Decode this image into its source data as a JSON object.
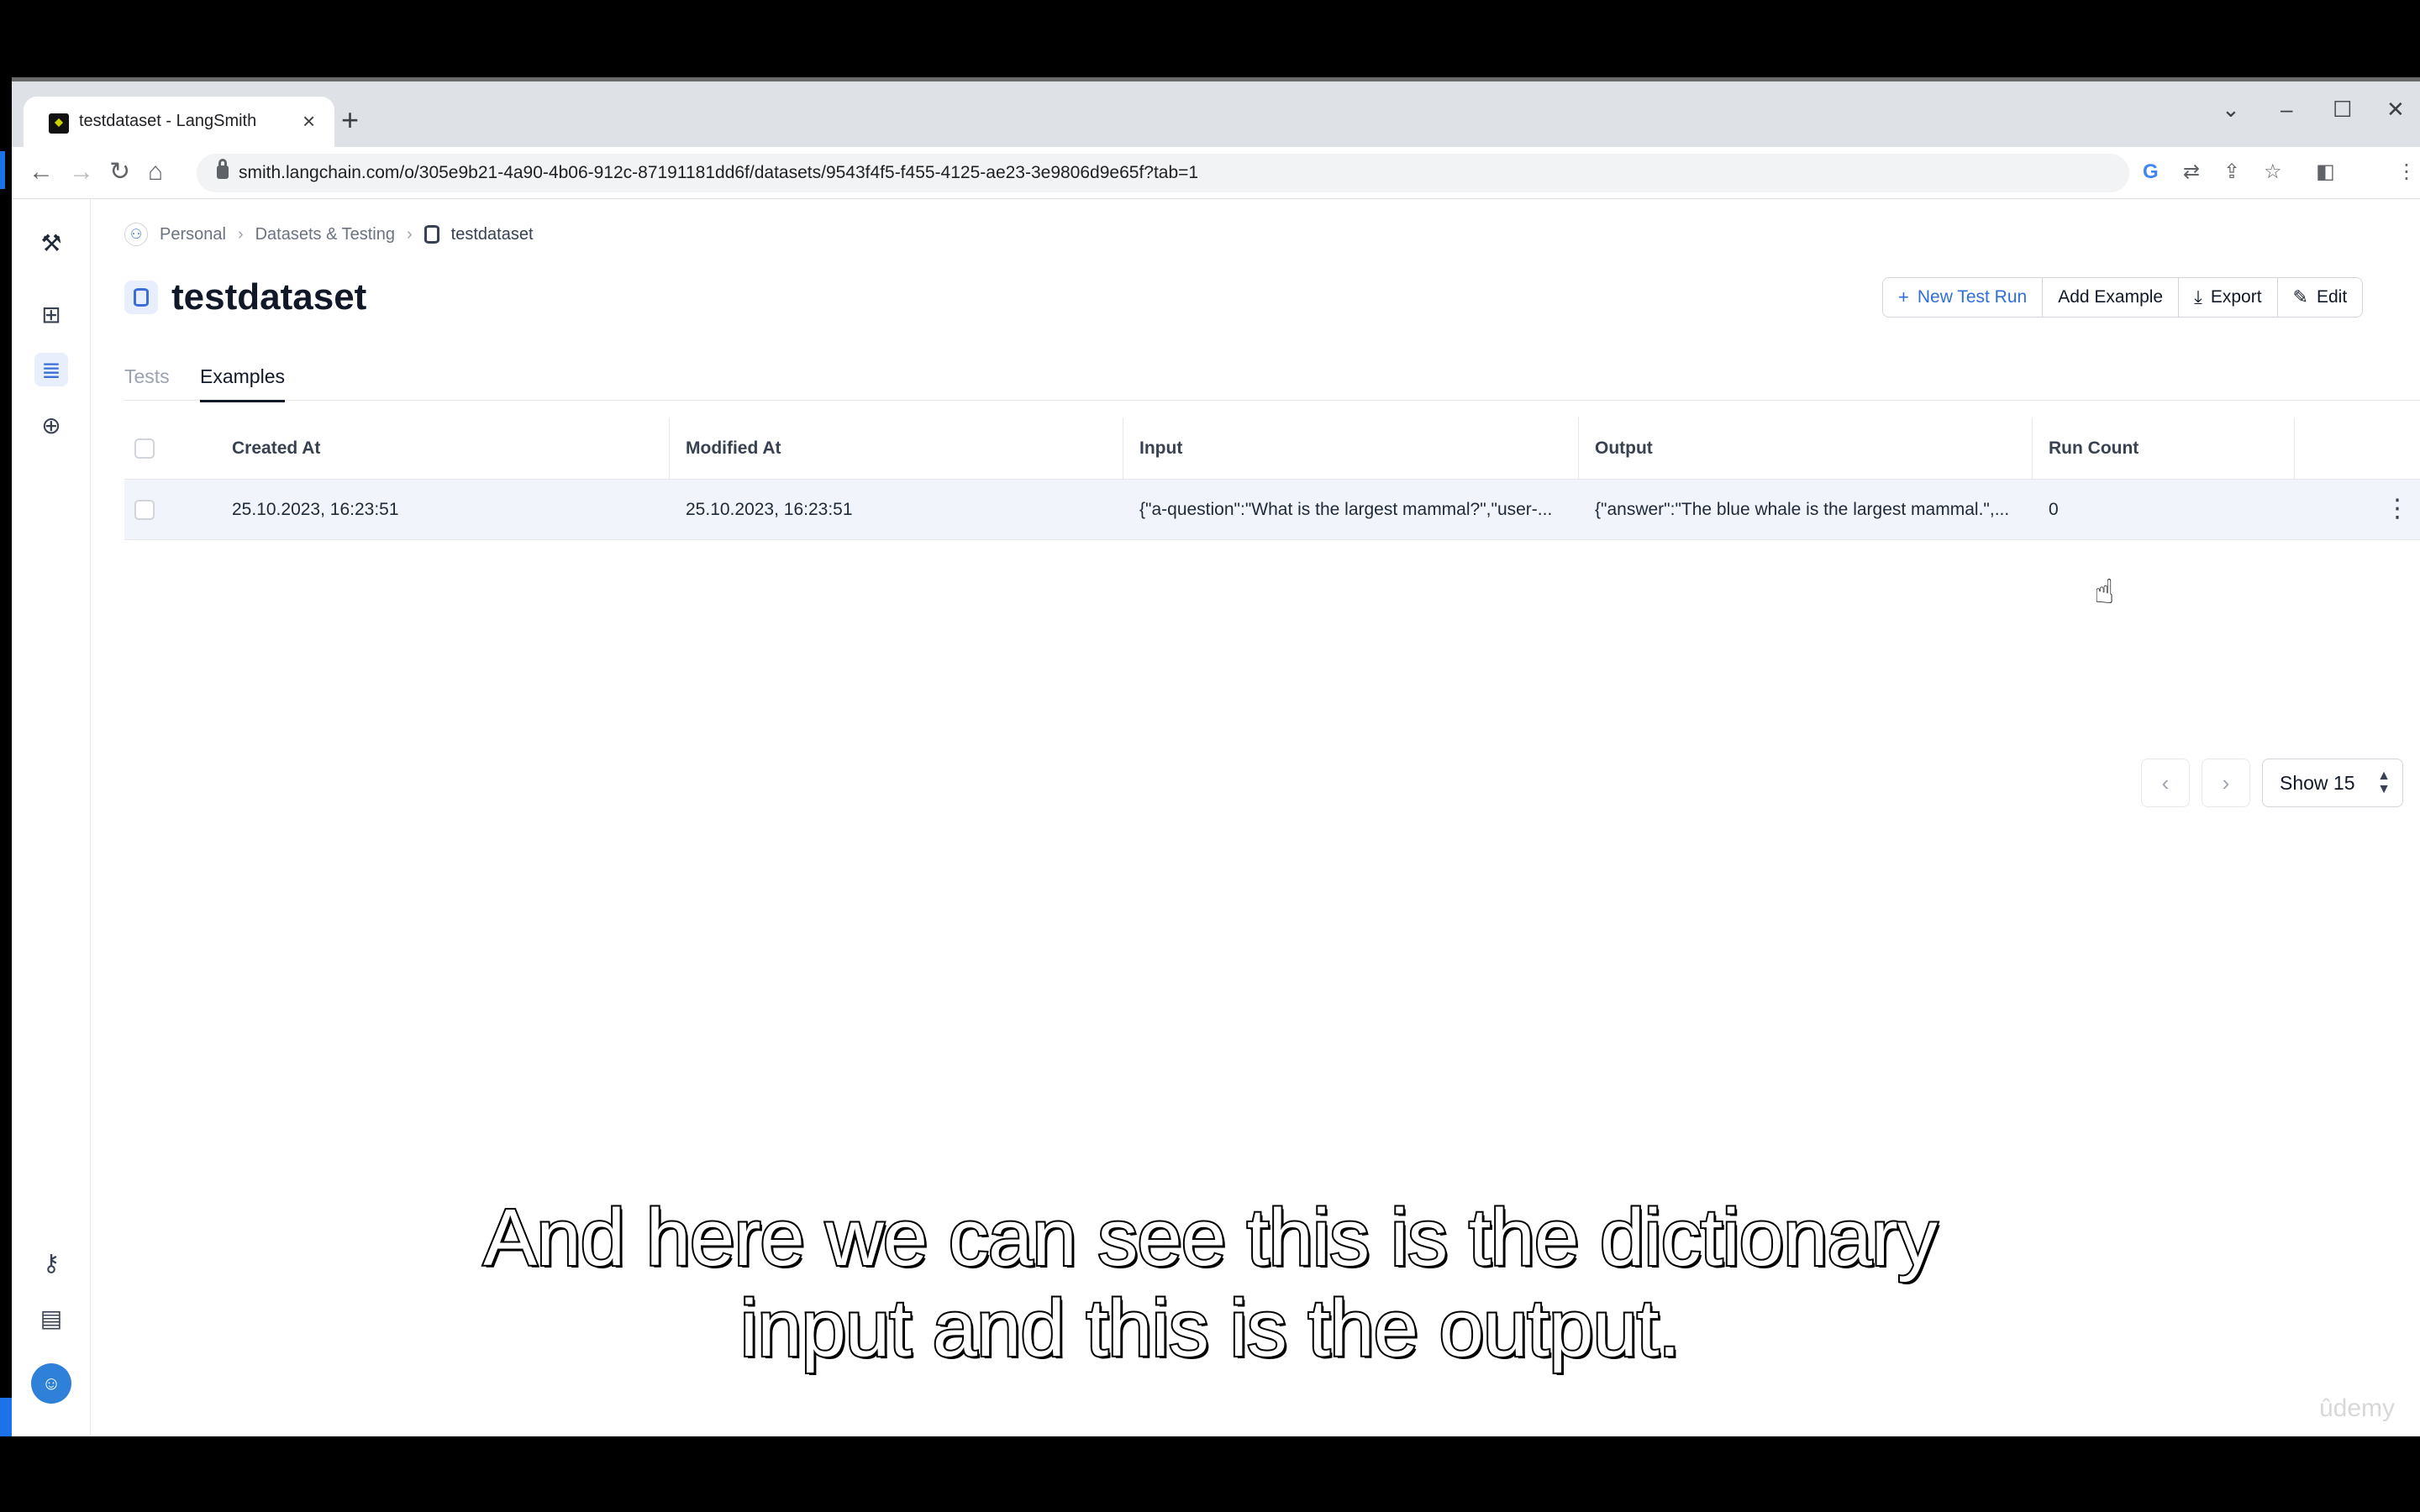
{
  "browser": {
    "tab_title": "testdataset - LangSmith",
    "tab_close": "×",
    "new_tab": "+",
    "url": "smith.langchain.com/o/305e9b21-4a90-4b06-912c-87191181dd6f/datasets/9543f4f5-f455-4125-ae23-3e9806d9e65f?tab=1",
    "nav": {
      "back": "←",
      "forward": "→",
      "reload": "↻",
      "home": "⌂"
    },
    "window": {
      "tabsearch": "⌄",
      "minimize": "–",
      "maximize": "☐",
      "close": "✕"
    },
    "extensions": [
      "G",
      "⇄",
      "⇪",
      "☆",
      "◧",
      "⋮"
    ]
  },
  "sidebar": {
    "items": [
      {
        "name": "logo",
        "glyph": "⚒"
      },
      {
        "name": "projects",
        "glyph": "⊞"
      },
      {
        "name": "datasets",
        "glyph": "≣"
      },
      {
        "name": "hub",
        "glyph": "⊕"
      },
      {
        "name": "api-keys",
        "glyph": "⚷"
      },
      {
        "name": "docs",
        "glyph": "▤"
      }
    ],
    "avatar_glyph": "☺"
  },
  "breadcrumb": {
    "personal": "Personal",
    "datasets": "Datasets & Testing",
    "current": "testdataset",
    "sep": "›"
  },
  "page": {
    "title": "testdataset",
    "actions": {
      "new_test_run": "New Test Run",
      "add_example": "Add Example",
      "export": "Export",
      "edit": "Edit"
    },
    "tabs": {
      "tests": "Tests",
      "examples": "Examples"
    }
  },
  "table": {
    "headers": {
      "created_at": "Created At",
      "modified_at": "Modified At",
      "input": "Input",
      "output": "Output",
      "run_count": "Run Count"
    },
    "rows": [
      {
        "created_at": "25.10.2023, 16:23:51",
        "modified_at": "25.10.2023, 16:23:51",
        "input": "{\"a-question\":\"What is the largest mammal?\",\"user-...",
        "output": "{\"answer\":\"The blue whale is the largest mammal.\",...",
        "run_count": "0"
      }
    ]
  },
  "pagination": {
    "prev": "‹",
    "next": "›",
    "show": "Show 15"
  },
  "subtitle": {
    "line1": "And here we can see this is the dictionary",
    "line2": "input and this is the output."
  },
  "watermark": "ûdemy",
  "colors": {
    "accent": "#2f6fd6",
    "row_highlight": "#f1f4fb"
  }
}
